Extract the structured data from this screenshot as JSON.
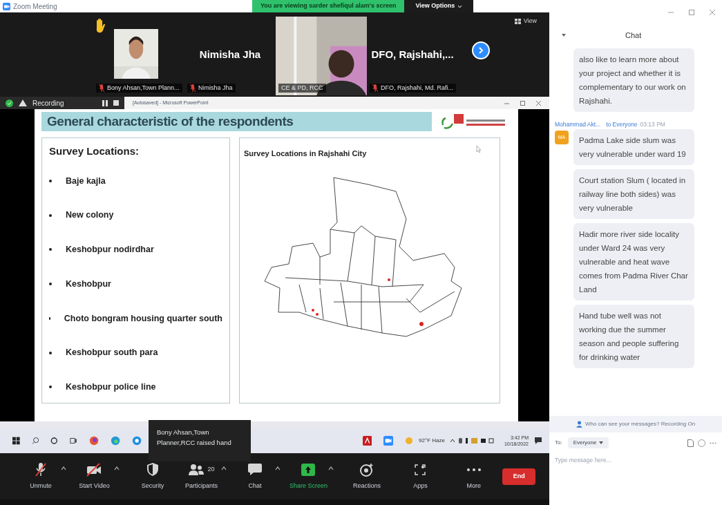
{
  "window": {
    "title": "Zoom Meeting",
    "banner": "You are viewing sarder shefiqul alam's screen",
    "view_options": "View Options"
  },
  "gallery": {
    "view_label": "View",
    "tiles": [
      {
        "kind": "video",
        "label": "Bony Ahsan,Town Plann...",
        "hand_raised": true,
        "muted": true
      },
      {
        "kind": "name",
        "name": "Nimisha Jha",
        "label": "Nimisha Jha",
        "hand_raised": false,
        "muted": true
      },
      {
        "kind": "video",
        "label": "CE & PD, RCC",
        "hand_raised": false,
        "muted": false
      },
      {
        "kind": "name",
        "name": "DFO, Rajshahi,...",
        "label": "DFO, Rajshahi, Md. Rafi...",
        "hand_raised": false,
        "muted": true
      }
    ]
  },
  "recording": {
    "label": "Recording"
  },
  "powerpoint": {
    "title": "[Autosaved] - Microsoft PowerPoint"
  },
  "slide": {
    "title": "General characteristic of the respondents",
    "left_heading": "Survey Locations:",
    "locations": [
      "Baje kajla",
      "New colony",
      "Keshobpur nodirdhar",
      "Keshobpur",
      "Choto bongram housing quarter south",
      "Keshobpur south para",
      "Keshobpur police line"
    ],
    "map_title": "Survey Locations in Rajshahi City"
  },
  "taskbar": {
    "weather": "92°F Haze",
    "time": "3:42 PM",
    "date": "10/18/2022"
  },
  "tooltip": "Bony Ahsan,Town Planner,RCC raised hand",
  "toolbar": [
    {
      "kind": "mic",
      "label": "Unmute",
      "menu": true
    },
    {
      "kind": "video",
      "label": "Start Video",
      "menu": true
    },
    {
      "kind": "security",
      "label": "Security",
      "menu": false
    },
    {
      "kind": "participants",
      "label": "Participants",
      "count": "20",
      "menu": true
    },
    {
      "kind": "chat",
      "label": "Chat",
      "menu": true
    },
    {
      "kind": "share",
      "label": "Share Screen",
      "menu": true
    },
    {
      "kind": "reactions",
      "label": "Reactions",
      "menu": false
    },
    {
      "kind": "apps",
      "label": "Apps",
      "menu": false
    },
    {
      "kind": "more",
      "label": "More",
      "menu": false
    },
    {
      "kind": "end",
      "label": "End"
    }
  ],
  "chat": {
    "title": "Chat",
    "messages": [
      {
        "text": "also like to learn more about your  project and whether it is complementary to our work on Rajshahi."
      },
      {
        "sender": "Mohammad Akt...",
        "to": "to Everyone",
        "time": "03:13 PM",
        "initials": "MA",
        "text": "Padma Lake side slum was very vulnerable under ward 19"
      },
      {
        "text": "Court station Slum ( located in railway line both sides) was very vulnerable"
      },
      {
        "text": "Hadir more river side locality under Ward 24 was very vulnerable and heat wave comes from Padma River Char Land"
      },
      {
        "text": "Hand tube well was not working due the summer season and people suffering for drinking water"
      }
    ],
    "notice": "Who can see your messages? Recording On",
    "to_label": "To:",
    "recipient": "Everyone",
    "placeholder": "Type message here..."
  }
}
